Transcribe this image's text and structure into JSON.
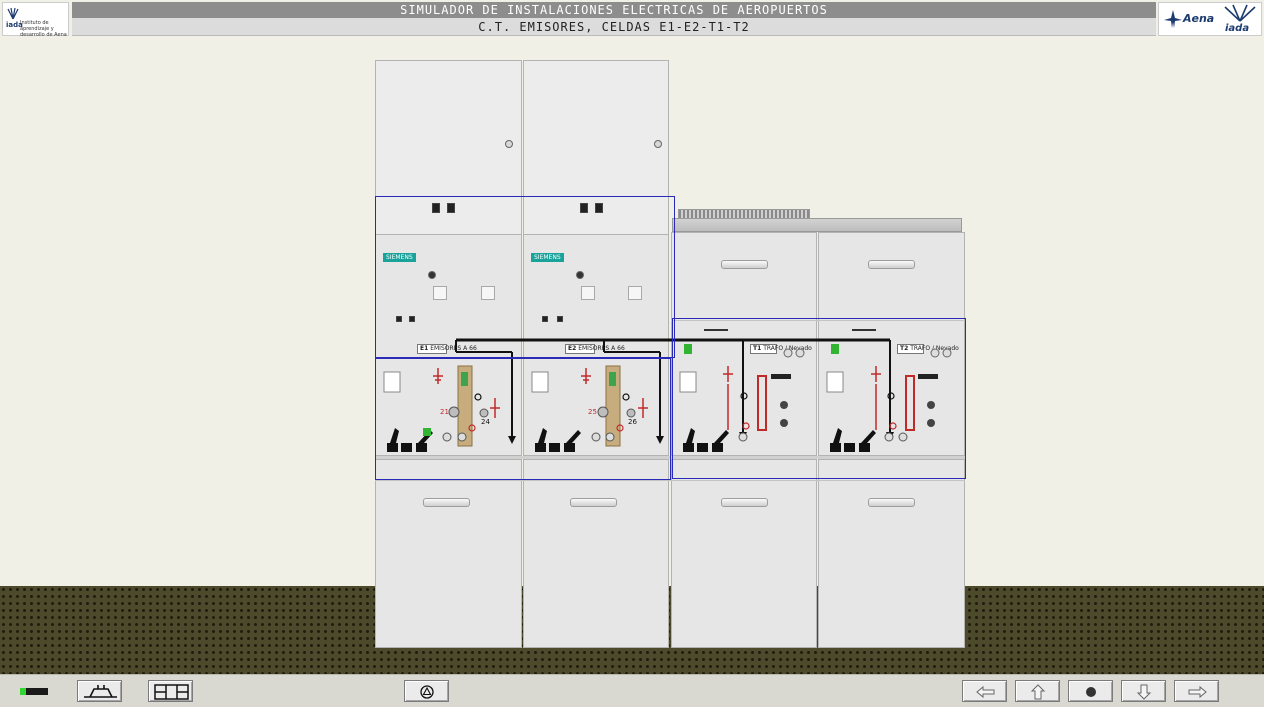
{
  "header": {
    "title": "SIMULADOR DE INSTALACIONES ELECTRICAS DE AEROPUERTOS",
    "subtitle": "C.T. EMISORES, CELDAS E1-E2-T1-T2",
    "logo_left": {
      "brand": "iada",
      "tagline": "Instituto de aprendizaje y desarrollo de Aena"
    },
    "logo_right": {
      "brand_a": "Aena",
      "brand_b": "iada"
    }
  },
  "cells": [
    {
      "id": "E1",
      "brand": "SIEMENS",
      "plate": "E1",
      "plate_sub": "EMISORES A 66",
      "labels": [
        "21",
        "24"
      ]
    },
    {
      "id": "E2",
      "brand": "SIEMENS",
      "plate": "E2",
      "plate_sub": "EMISORES A 66",
      "labels": [
        "25",
        "26"
      ]
    },
    {
      "id": "T1",
      "plate": "T1",
      "plate_sub": "TRAFO / Nevado"
    },
    {
      "id": "T2",
      "plate": "T2",
      "plate_sub": "TRAFO / Nevado"
    }
  ],
  "toolbar": {
    "status": "on",
    "buttons": [
      "single-line-diagram-icon",
      "panel-layout-icon",
      "alarm-icon",
      "arrow-left-icon",
      "arrow-up-icon",
      "record-icon",
      "arrow-down-icon",
      "arrow-right-icon"
    ]
  },
  "colors": {
    "accent": "#2a2ab8",
    "header": "#8d8d8d",
    "siemens": "#1aa39a",
    "status_red": "#c22a2a",
    "status_green": "#31d631"
  }
}
